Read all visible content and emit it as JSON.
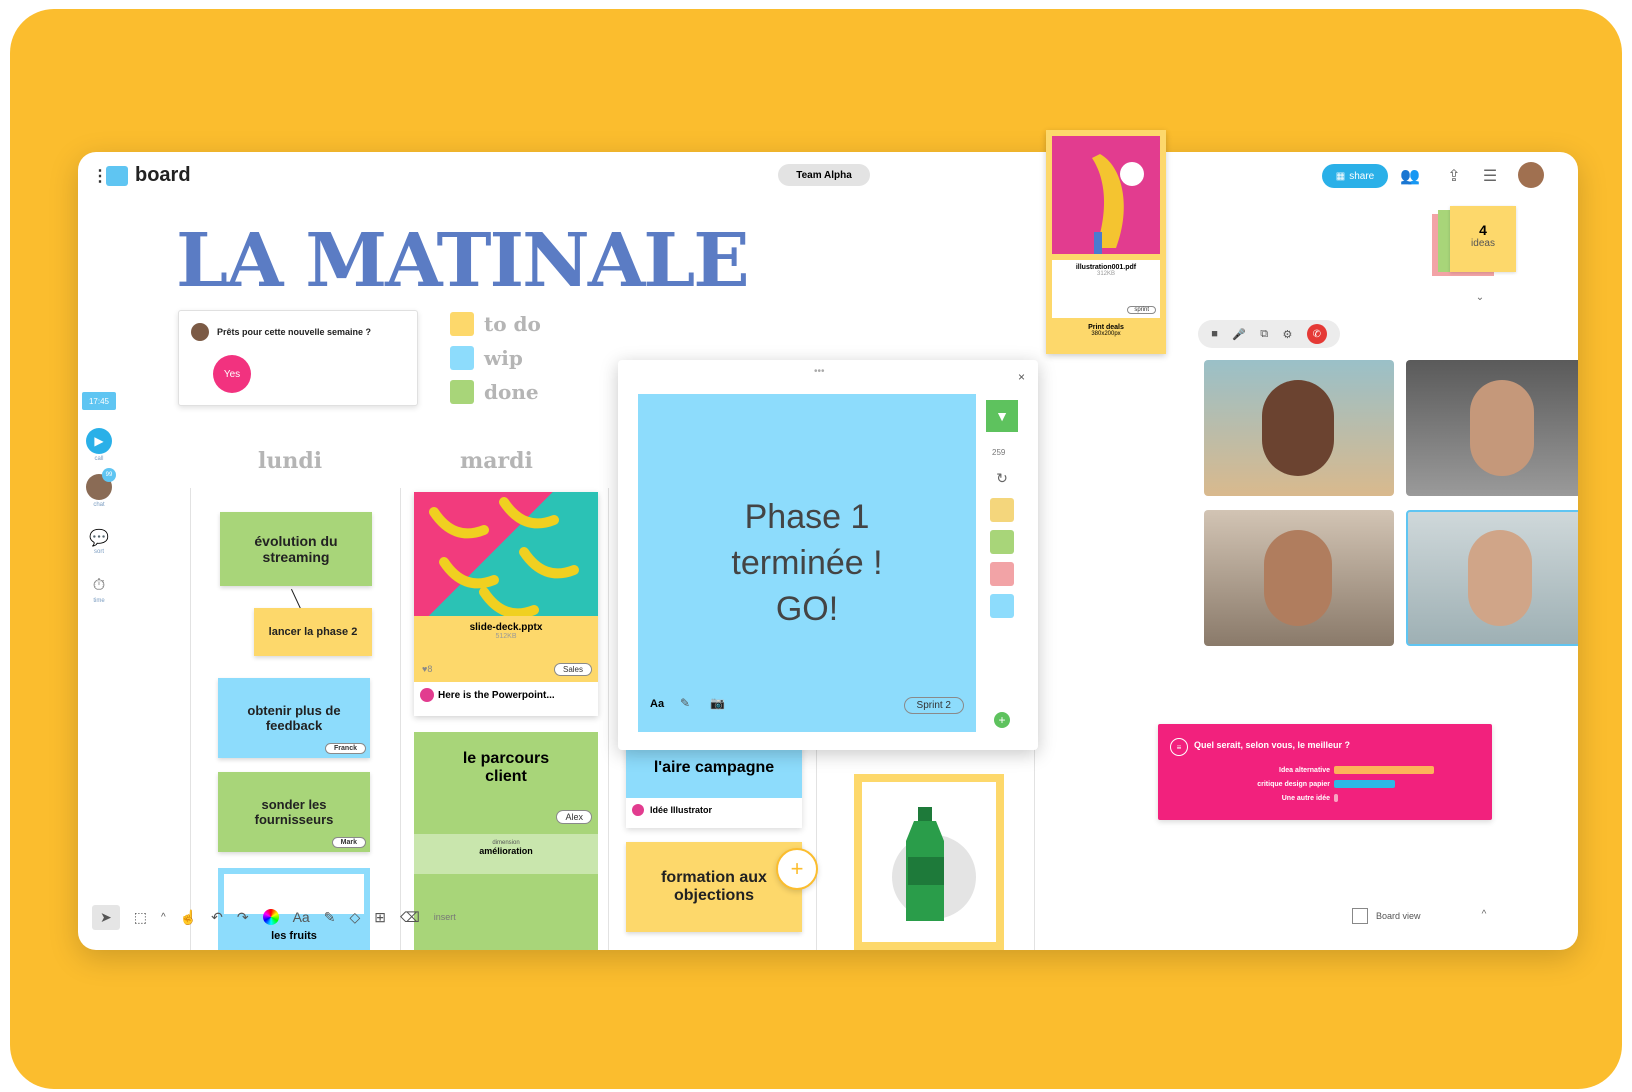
{
  "app": {
    "name": "board",
    "team": "Team Alpha",
    "share_label": "share"
  },
  "board_title": "LA MATINALE",
  "chat": {
    "message": "Prêts pour cette nouvelle semaine ?",
    "reply": "Yes"
  },
  "legend": [
    {
      "label": "to do",
      "color": "#fdd86b"
    },
    {
      "label": "wip",
      "color": "#8ddcfc"
    },
    {
      "label": "done",
      "color": "#a8d579"
    }
  ],
  "columns": {
    "lundi": "lundi",
    "mardi": "mardi"
  },
  "rail": {
    "time": "17:45",
    "call_label": "call",
    "avatar_badge": "99",
    "avatar_label": "chat",
    "chat_label": "sort",
    "timer_label": "time"
  },
  "lundi_cards": {
    "card1": "évolution du streaming",
    "card2": "lancer la phase 2",
    "card3": "obtenir plus de feedback",
    "card3_tag": "Franck",
    "card4": "sonder les fournisseurs",
    "card4_tag": "Mark",
    "card5": "les fruits"
  },
  "mardi_cards": {
    "file_name": "slide-deck.pptx",
    "file_size": "512KB",
    "likes": "♥8",
    "file_tag": "Sales",
    "comment": "Here is the Powerpoint...",
    "card_parcours": "le parcours client",
    "parcours_tag": "Alex",
    "parcours_sub1": "dimension",
    "parcours_sub2": "amélioration"
  },
  "col3_cards": {
    "campaign": "l'aire campagne",
    "campaign_comment": "Idée Illustrator",
    "formation": "formation aux objections"
  },
  "popup": {
    "text_line1": "Phase 1",
    "text_line2": "terminée !",
    "text_line3": "GO!",
    "sprint_tag": "Sprint 2",
    "text_tool": "Aa",
    "count": "259",
    "swatches": [
      "#f4d67c",
      "#a8d579",
      "#f2a3a6",
      "#8ddcfc"
    ]
  },
  "pdf": {
    "name": "illustration001.pdf",
    "size": "312KB",
    "tag": "sprint",
    "footer1": "Print deals",
    "footer2": "380x200px"
  },
  "ideas": {
    "count": "4",
    "label": "ideas"
  },
  "poll": {
    "question": "Quel serait, selon vous, le meilleur ?",
    "options": [
      "Idea alternative",
      "critique design papier",
      "Une autre idée"
    ],
    "values": [
      0.62,
      0.38,
      0.02
    ],
    "colors": [
      "#fdb35a",
      "#2eb8e6",
      "#f8a5c2"
    ]
  },
  "toolbar": {
    "text_tool": "Aa",
    "insert_label": "insert",
    "board_view": "Board view"
  }
}
